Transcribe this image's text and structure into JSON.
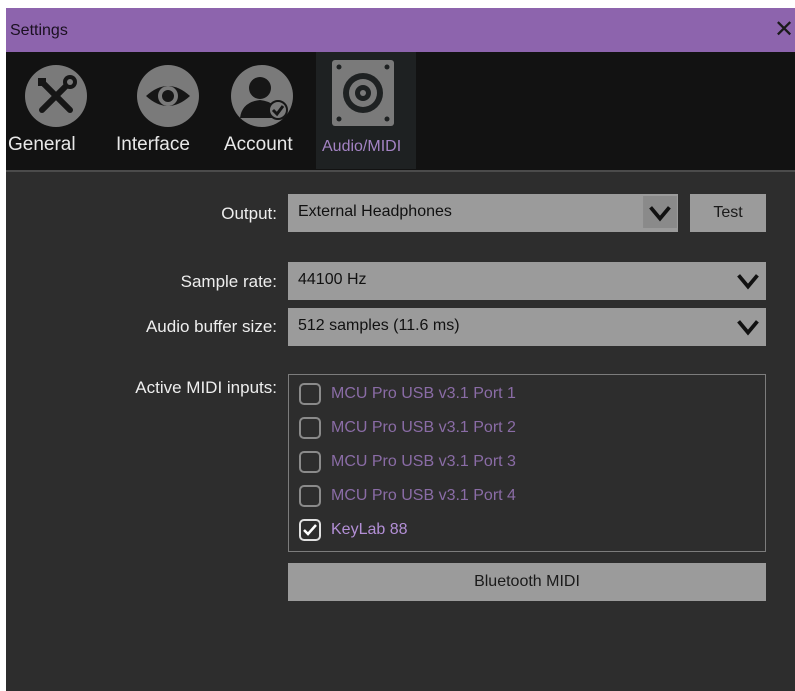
{
  "window": {
    "title": "Settings",
    "close_glyph": "✕"
  },
  "tabs": [
    {
      "label": "General",
      "icon": "wrench-screwdriver-icon",
      "active": false
    },
    {
      "label": "Interface",
      "icon": "eye-icon",
      "active": false
    },
    {
      "label": "Account",
      "icon": "user-check-icon",
      "active": false
    },
    {
      "label": "Audio/MIDI",
      "icon": "speaker-icon",
      "active": true
    }
  ],
  "audio": {
    "output_label": "Output:",
    "output_value": "External Headphones",
    "test_label": "Test",
    "sample_rate_label": "Sample rate:",
    "sample_rate_value": "44100 Hz",
    "buffer_label": "Audio buffer size:",
    "buffer_value": "512 samples (11.6 ms)"
  },
  "midi": {
    "label": "Active MIDI inputs:",
    "inputs": [
      {
        "name": "MCU Pro USB v3.1 Port 1",
        "checked": false
      },
      {
        "name": "MCU Pro USB v3.1 Port 2",
        "checked": false
      },
      {
        "name": "MCU Pro USB v3.1 Port 3",
        "checked": false
      },
      {
        "name": "MCU Pro USB v3.1 Port 4",
        "checked": false
      },
      {
        "name": "KeyLab 88",
        "checked": true
      }
    ],
    "bluetooth_label": "Bluetooth MIDI"
  },
  "colors": {
    "titlebar": "#8d64ad",
    "accent": "#a483c4",
    "panel": "#2d2d2d",
    "control": "#9b9b9b"
  }
}
